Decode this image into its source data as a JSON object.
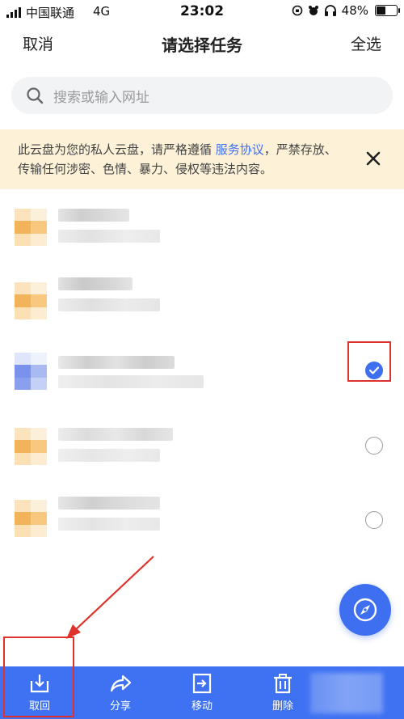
{
  "status_bar": {
    "carrier": "中国联通",
    "network": "4G",
    "time": "23:02",
    "battery": "48%"
  },
  "header": {
    "cancel": "取消",
    "title": "请选择任务",
    "select_all": "全选"
  },
  "search": {
    "placeholder": "搜索或输入网址"
  },
  "notice": {
    "text_before": "此云盘为您的私人云盘，请严格遵循 ",
    "link": "服务协议",
    "text_after": "，严禁存放、传输任何涉密、色情、暴力、侵权等违法内容。"
  },
  "files": [
    {
      "checkbox": "none",
      "thumb_color": "orange"
    },
    {
      "checkbox": "none",
      "thumb_color": "orange"
    },
    {
      "checkbox": "checked",
      "thumb_color": "blue"
    },
    {
      "checkbox": "unchecked",
      "thumb_color": "orange"
    },
    {
      "checkbox": "unchecked",
      "thumb_color": "orange"
    }
  ],
  "toolbar": {
    "retrieve": "取回",
    "share": "分享",
    "move": "移动",
    "delete": "删除"
  },
  "colors": {
    "accent": "#3f6ff1",
    "annotation": "#e0322c",
    "notice_bg": "#fdf1d8"
  },
  "icons": [
    "signal-icon",
    "alarm-icon",
    "headphones-icon",
    "battery-icon",
    "search-icon",
    "close-icon",
    "check-icon",
    "compass-icon",
    "download-icon",
    "share-icon",
    "move-icon",
    "trash-icon"
  ]
}
